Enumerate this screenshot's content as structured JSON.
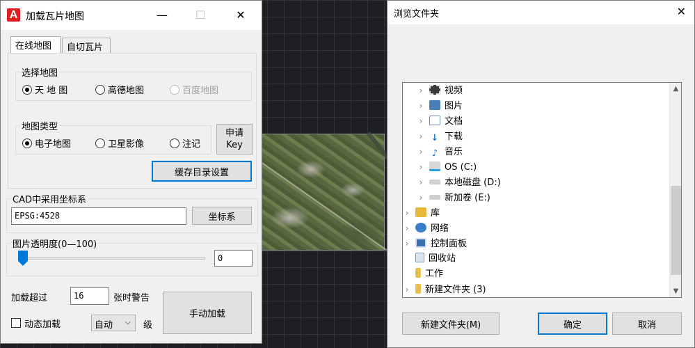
{
  "left_dialog": {
    "title": "加载瓦片地图",
    "minimize_glyph": "—",
    "maximize_glyph": "☐",
    "close_glyph": "✕",
    "tabs": [
      {
        "label": "在线地图",
        "active": true
      },
      {
        "label": "自切瓦片",
        "active": false
      }
    ],
    "select_map": {
      "label": "选择地图",
      "options": [
        {
          "label": "天 地 图",
          "checked": true,
          "enabled": true
        },
        {
          "label": "高德地图",
          "checked": false,
          "enabled": true
        },
        {
          "label": "百度地图",
          "checked": false,
          "enabled": false
        }
      ]
    },
    "map_type": {
      "label": "地图类型",
      "options": [
        {
          "label": "电子地图",
          "checked": true
        },
        {
          "label": "卫星影像",
          "checked": false
        },
        {
          "label": "注记",
          "checked": false
        }
      ]
    },
    "apply_key_button": {
      "line1": "申请",
      "line2": "Key"
    },
    "cache_dir_button": "缓存目录设置",
    "cad_coord": {
      "label": "CAD中采用坐标系",
      "value": "EPSG:4528",
      "button": "坐标系"
    },
    "transparency": {
      "label": "图片透明度(0—100)",
      "value": "0",
      "level": 0
    },
    "load_warning": {
      "prefix": "加载超过",
      "value": "16",
      "suffix": "张时警告"
    },
    "dynamic_load": {
      "label": "动态加载",
      "checked": false
    },
    "level_select": {
      "value": "自动",
      "suffix": "级"
    },
    "manual_load_button": "手动加载"
  },
  "right_dialog": {
    "title": "浏览文件夹",
    "close_glyph": "✕",
    "tree": [
      {
        "label": "视频",
        "icon": "video-icon",
        "color": "#3a3a3a"
      },
      {
        "label": "图片",
        "icon": "pictures-icon",
        "color": "#4a7fb5"
      },
      {
        "label": "文档",
        "icon": "documents-icon",
        "color": "#6a8fb7"
      },
      {
        "label": "下载",
        "icon": "download-icon",
        "color": "#1e7fd8"
      },
      {
        "label": "音乐",
        "icon": "music-icon",
        "color": "#1e7fd8"
      },
      {
        "label": "OS (C:)",
        "icon": "drive-os-icon",
        "color": "#2a9de0"
      },
      {
        "label": "本地磁盘 (D:)",
        "icon": "drive-icon",
        "color": "#9a9a9a"
      },
      {
        "label": "新加卷 (E:)",
        "icon": "drive-icon",
        "color": "#9a9a9a"
      },
      {
        "label": "库",
        "icon": "library-icon",
        "color": "#e8b83a"
      },
      {
        "label": "网络",
        "icon": "network-icon",
        "color": "#3a7fc8"
      },
      {
        "label": "控制面板",
        "icon": "control-panel-icon",
        "color": "#3a6fb0"
      },
      {
        "label": "回收站",
        "icon": "recycle-bin-icon",
        "color": "#7a9ab8"
      },
      {
        "label": "工作",
        "icon": "folder-icon",
        "color": "#e8c050"
      },
      {
        "label": "新建文件夹 (3)",
        "icon": "folder-icon",
        "color": "#e8c050"
      }
    ],
    "new_folder_button": "新建文件夹(M)",
    "ok_button": "确定",
    "cancel_button": "取消"
  },
  "colors": {
    "accent": "#0078d7",
    "dialog_bg": "#f0f0f0",
    "canvas_bg": "#1d1f22"
  }
}
